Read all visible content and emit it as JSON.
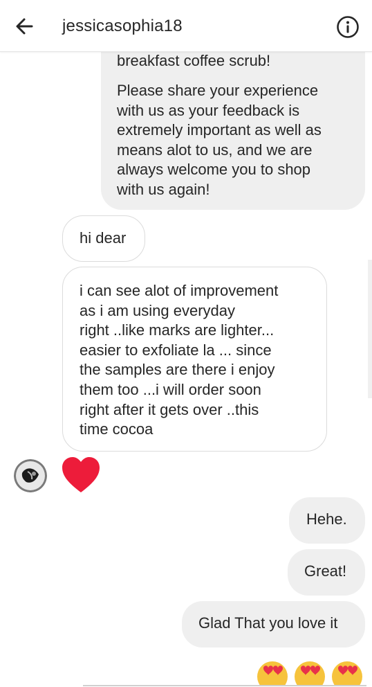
{
  "header": {
    "back_icon": "arrow-left-icon",
    "title": "jessicasophia18",
    "info_icon": "info-circle-icon"
  },
  "messages": [
    {
      "id": "m1",
      "sender": "me",
      "cut_text": "breakfast coffee scrub!",
      "lines": [
        "Please share your experience",
        "with us as your feedback is",
        "extremely important as well as",
        "means alot to us, and we are",
        "always welcome you to shop",
        "with us again!"
      ]
    },
    {
      "id": "m2",
      "sender": "them",
      "lines": [
        "hi dear"
      ]
    },
    {
      "id": "m3",
      "sender": "them",
      "lines": [
        "i can see alot of improvement",
        "as i am using everyday",
        "right ..like marks are lighter...",
        "easier to exfoliate la ... since",
        "the samples are there i enjoy",
        "them too ...i will order soon",
        "right after it gets over ..this",
        "time cocoa"
      ]
    },
    {
      "id": "m4",
      "sender": "them",
      "reaction": "heart-icon",
      "avatar": "avatar"
    },
    {
      "id": "m5",
      "sender": "me",
      "lines": [
        "Hehe."
      ]
    },
    {
      "id": "m6",
      "sender": "me",
      "lines": [
        "Great!"
      ]
    },
    {
      "id": "m7",
      "sender": "me",
      "lines": [
        "Glad That you love it"
      ]
    },
    {
      "id": "m8",
      "sender": "me",
      "emojis": [
        "heart-eyes-emoji",
        "heart-eyes-emoji",
        "heart-eyes-emoji"
      ]
    }
  ],
  "colors": {
    "outgoing_bubble": "#efefef",
    "incoming_border": "#dbdbdb",
    "heart": "#ed1c3a",
    "text": "#262626"
  }
}
